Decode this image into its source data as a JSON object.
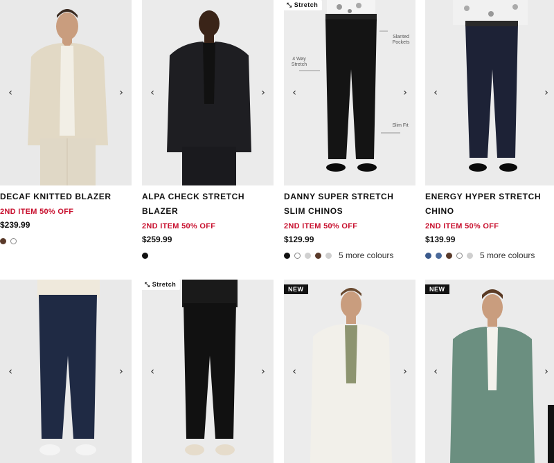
{
  "arrows": {
    "prev": "‹",
    "next": "›"
  },
  "products": [
    {
      "title": "DECAF KNITTED BLAZER",
      "promo": "2ND ITEM 50% OFF",
      "price": "$239.99",
      "swatches": [
        "#5a3a2a",
        "#ffffff"
      ],
      "more": ""
    },
    {
      "title": "ALPA CHECK STRETCH BLAZER",
      "promo": "2ND ITEM 50% OFF",
      "price": "$259.99",
      "swatches": [
        "#111111"
      ],
      "more": ""
    },
    {
      "title": "DANNY SUPER STRETCH SLIM CHINOS",
      "promo": "2ND ITEM 50% OFF",
      "price": "$129.99",
      "swatches": [
        "#111111",
        "#ffffff",
        "#d0d0d0",
        "#5a3a2a",
        "#cfcfcf"
      ],
      "more": "5 more colours",
      "badge": "Stretch",
      "annotations": {
        "pockets": "Slanted Pockets",
        "stretch": "4 Way Stretch",
        "fit": "Slim Fit"
      }
    },
    {
      "title": "ENERGY HYPER STRETCH CHINO",
      "promo": "2ND ITEM 50% OFF",
      "price": "$139.99",
      "swatches": [
        "#3b5a8c",
        "#4b6a9a",
        "#5a3a2a",
        "#ffffff",
        "#cfcfcf"
      ],
      "more": "5 more colours"
    },
    {
      "badge": ""
    },
    {
      "badge": "Stretch"
    },
    {
      "badge": "NEW"
    },
    {
      "badge": "NEW"
    }
  ]
}
